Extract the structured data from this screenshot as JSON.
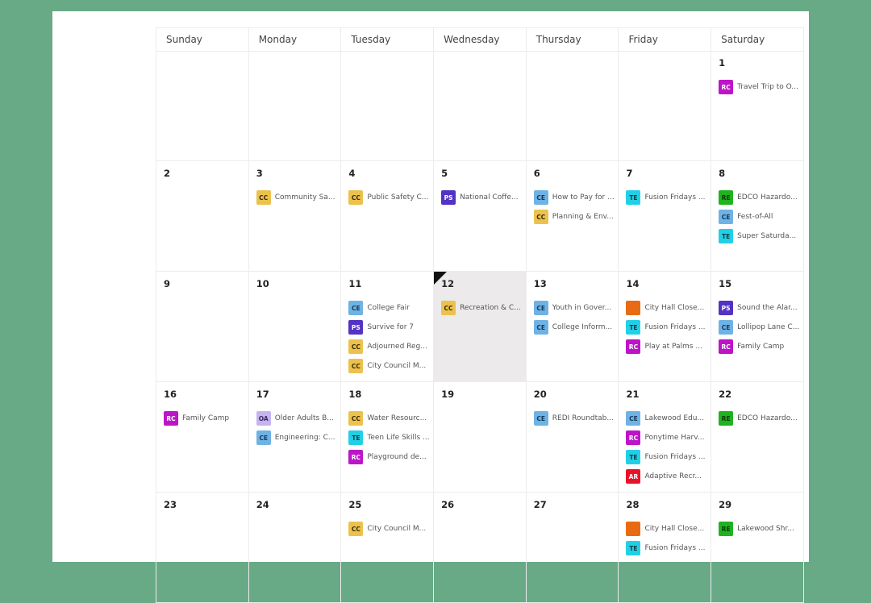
{
  "colors": {
    "background": "#67aa85",
    "CC": "#ecc24e",
    "CE": "#6fb2e4",
    "PS": "#5333c4",
    "RC": "#bd14c9",
    "TE": "#22d0e6",
    "RE": "#1fb31f",
    "OA": "#c6b4ef",
    "AR": "#e8132b",
    "closure": "#e86a12"
  },
  "weekdays": [
    "Sunday",
    "Monday",
    "Tuesday",
    "Wednesday",
    "Thursday",
    "Friday",
    "Saturday"
  ],
  "today": "12",
  "weeks": [
    [
      {
        "day": "",
        "events": []
      },
      {
        "day": "",
        "events": []
      },
      {
        "day": "",
        "events": []
      },
      {
        "day": "",
        "events": []
      },
      {
        "day": "",
        "events": []
      },
      {
        "day": "",
        "events": []
      },
      {
        "day": "1",
        "events": [
          {
            "code": "RC",
            "title": "Travel Trip to O..."
          }
        ]
      }
    ],
    [
      {
        "day": "2",
        "events": []
      },
      {
        "day": "3",
        "events": [
          {
            "code": "CC",
            "title": "Community Sa..."
          }
        ]
      },
      {
        "day": "4",
        "events": [
          {
            "code": "CC",
            "title": "Public Safety C..."
          }
        ]
      },
      {
        "day": "5",
        "events": [
          {
            "code": "PS",
            "title": "National Coffe..."
          }
        ]
      },
      {
        "day": "6",
        "events": [
          {
            "code": "CE",
            "title": "How to Pay for ..."
          },
          {
            "code": "CC",
            "title": "Planning & Env..."
          }
        ]
      },
      {
        "day": "7",
        "events": [
          {
            "code": "TE",
            "title": "Fusion Fridays ..."
          }
        ]
      },
      {
        "day": "8",
        "events": [
          {
            "code": "RE",
            "title": "EDCO Hazardo..."
          },
          {
            "code": "CE",
            "title": "Fest-of-All"
          },
          {
            "code": "TE",
            "title": "Super Saturda..."
          }
        ]
      }
    ],
    [
      {
        "day": "9",
        "events": []
      },
      {
        "day": "10",
        "events": []
      },
      {
        "day": "11",
        "events": [
          {
            "code": "CE",
            "title": "College Fair"
          },
          {
            "code": "PS",
            "title": "Survive for 7"
          },
          {
            "code": "CC",
            "title": "Adjourned Reg..."
          },
          {
            "code": "CC",
            "title": "City Council M..."
          }
        ]
      },
      {
        "day": "12",
        "events": [
          {
            "code": "CC",
            "title": "Recreation & C..."
          }
        ]
      },
      {
        "day": "13",
        "events": [
          {
            "code": "CE",
            "title": "Youth in Gover..."
          },
          {
            "code": "CE",
            "title": "College Inform..."
          }
        ]
      },
      {
        "day": "14",
        "events": [
          {
            "code": "",
            "color": "closure",
            "title": "City Hall Close..."
          },
          {
            "code": "TE",
            "title": "Fusion Fridays ..."
          },
          {
            "code": "RC",
            "title": "Play at Palms ..."
          }
        ]
      },
      {
        "day": "15",
        "events": [
          {
            "code": "PS",
            "title": "Sound the Alar..."
          },
          {
            "code": "CE",
            "title": "Lollipop Lane C..."
          },
          {
            "code": "RC",
            "title": "Family Camp"
          }
        ]
      }
    ],
    [
      {
        "day": "16",
        "events": [
          {
            "code": "RC",
            "title": "Family Camp"
          }
        ]
      },
      {
        "day": "17",
        "events": [
          {
            "code": "OA",
            "title": "Older Adults B..."
          },
          {
            "code": "CE",
            "title": "Engineering: C..."
          }
        ]
      },
      {
        "day": "18",
        "events": [
          {
            "code": "CC",
            "title": "Water Resourc..."
          },
          {
            "code": "TE",
            "title": "Teen Life Skills ..."
          },
          {
            "code": "RC",
            "title": "Playground de..."
          }
        ]
      },
      {
        "day": "19",
        "events": []
      },
      {
        "day": "20",
        "events": [
          {
            "code": "CE",
            "title": "REDI Roundtab..."
          }
        ]
      },
      {
        "day": "21",
        "events": [
          {
            "code": "CE",
            "title": "Lakewood Edu..."
          },
          {
            "code": "RC",
            "title": "Ponytime Harv..."
          },
          {
            "code": "TE",
            "title": "Fusion Fridays ..."
          },
          {
            "code": "AR",
            "title": "Adaptive Recr..."
          }
        ]
      },
      {
        "day": "22",
        "events": [
          {
            "code": "RE",
            "title": "EDCO Hazardo..."
          }
        ]
      }
    ],
    [
      {
        "day": "23",
        "events": []
      },
      {
        "day": "24",
        "events": []
      },
      {
        "day": "25",
        "events": [
          {
            "code": "CC",
            "title": "City Council M..."
          }
        ]
      },
      {
        "day": "26",
        "events": []
      },
      {
        "day": "27",
        "events": []
      },
      {
        "day": "28",
        "events": [
          {
            "code": "",
            "color": "closure",
            "title": "City Hall Close..."
          },
          {
            "code": "TE",
            "title": "Fusion Fridays ..."
          }
        ]
      },
      {
        "day": "29",
        "events": [
          {
            "code": "RE",
            "title": "Lakewood Shr..."
          }
        ]
      }
    ]
  ]
}
